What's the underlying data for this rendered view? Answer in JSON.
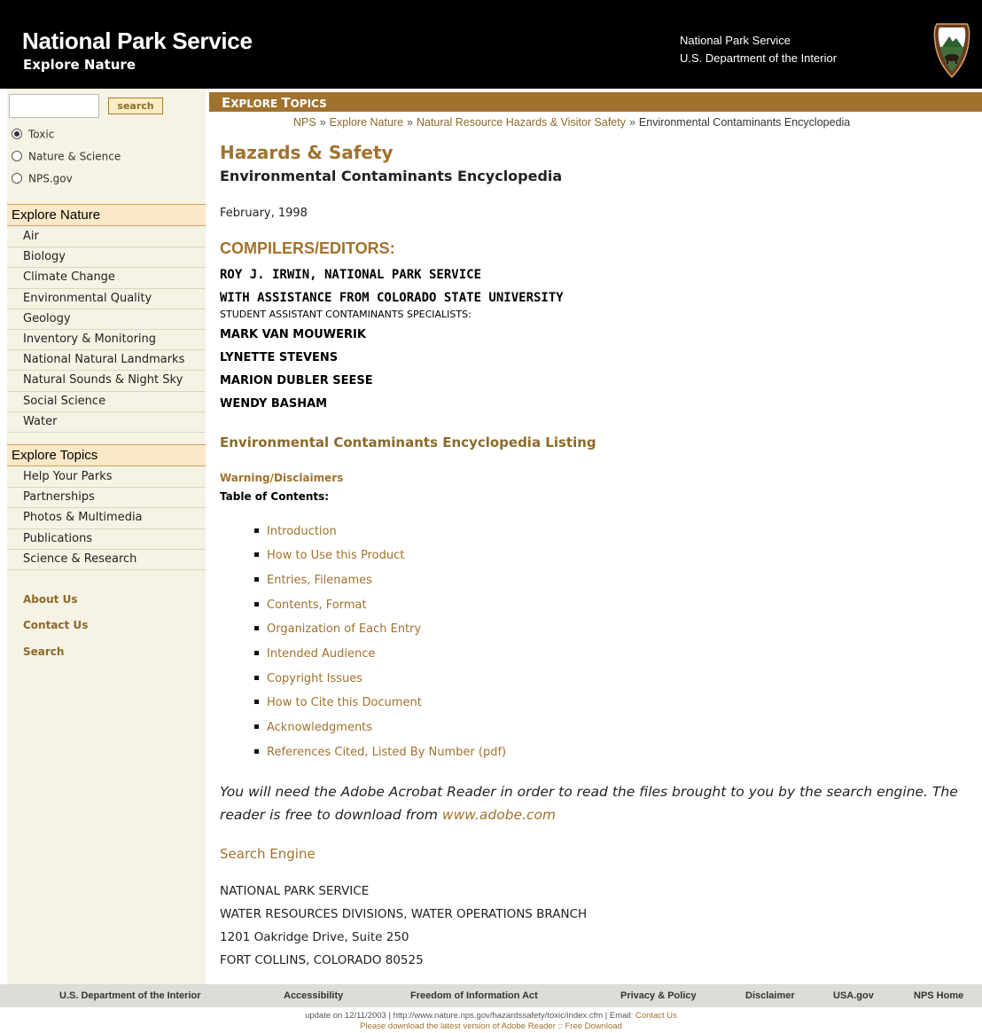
{
  "header": {
    "title": "National Park Service",
    "subtitle": "Explore Nature",
    "agency_line1": "National Park Service",
    "agency_line2": "U.S. Department of the Interior",
    "logo_icon": "nps-arrowhead-logo"
  },
  "sidebar": {
    "search_placeholder": "",
    "search_button": "search",
    "radios": [
      {
        "label": "Toxic",
        "selected": true
      },
      {
        "label": "Nature & Science",
        "selected": false
      },
      {
        "label": "NPS.gov",
        "selected": false
      }
    ],
    "explore_nature": {
      "heading": "Explore Nature",
      "items": [
        "Air",
        "Biology",
        "Climate Change",
        "Environmental Quality",
        "Geology",
        "Inventory & Monitoring",
        "National Natural Landmarks",
        "Natural Sounds & Night Sky",
        "Social Science",
        "Water"
      ]
    },
    "explore_topics": {
      "heading": "Explore Topics",
      "items": [
        "Help Your Parks",
        "Partnerships",
        "Photos & Multimedia",
        "Publications",
        "Science & Research"
      ]
    },
    "links": [
      "About Us",
      "Contact Us",
      "Search"
    ]
  },
  "main": {
    "topics_bar_first": "E",
    "topics_bar_rest_1": "XPLORE ",
    "topics_bar_T": "T",
    "topics_bar_rest_2": "OPICS",
    "breadcrumb": [
      "NPS",
      "Explore Nature",
      "Natural Resource Hazards & Visitor Safety",
      "Environmental Contaminants Encyclopedia"
    ],
    "breadcrumb_sep": "»",
    "title": "Hazards & Safety",
    "subtitle": "Environmental Contaminants Encyclopedia",
    "date": "February, 1998",
    "compilers_heading": "COMPILERS/EDITORS:",
    "compiler_1": "ROY J. IRWIN, NATIONAL PARK SERVICE",
    "compiler_2": "WITH ASSISTANCE FROM COLORADO STATE UNIVERSITY",
    "students_label": "STUDENT ASSISTANT CONTAMINANTS SPECIALISTS:",
    "students": [
      "MARK VAN MOUWERIK",
      "LYNETTE STEVENS",
      "MARION DUBLER SEESE",
      "WENDY BASHAM"
    ],
    "listing_title": "Environmental Contaminants Encyclopedia Listing",
    "warning_link": "Warning/Disclaimers",
    "toc_label": "Table of Contents:",
    "toc": [
      "Introduction",
      "How to Use this Product",
      "Entries, Filenames",
      "Contents, Format",
      "Organization of Each Entry",
      "Intended Audience",
      "Copyright Issues",
      "How to Cite this Document",
      "Acknowledgments",
      "References Cited, Listed By Number (pdf)"
    ],
    "adobe_note": "You will need the Adobe Acrobat Reader in order to read the files brought to you by the search engine. The reader is free to download from ",
    "adobe_link": "www.adobe.com",
    "search_engine": "Search Engine",
    "address": [
      "NATIONAL PARK SERVICE",
      "WATER RESOURCES DIVISIONS, WATER OPERATIONS BRANCH",
      "1201 Oakridge Drive, Suite 250",
      "FORT COLLINS, COLORADO 80525"
    ]
  },
  "footer": {
    "links": [
      "U.S. Department of the Interior",
      "Accessibility",
      "Freedom of Information Act",
      "Privacy & Policy",
      "Disclaimer",
      "USA.gov",
      "NPS Home"
    ],
    "update_text": "update on 12/11/2003  |  http://www.nature.nps.gov/hazardssafety/toxic/index.cfm  |  Email: ",
    "contact_link": "Contact Us",
    "download_text": "Please download the latest version of Adobe Reader :: Free Download"
  },
  "colors": {
    "header_bg": "#000000",
    "accent_brown": "#a0722e",
    "sidebar_bg": "#f6f2e4",
    "sidebar_heading_bg": "#fbe8c8",
    "footer_bg": "#dedcd6"
  }
}
